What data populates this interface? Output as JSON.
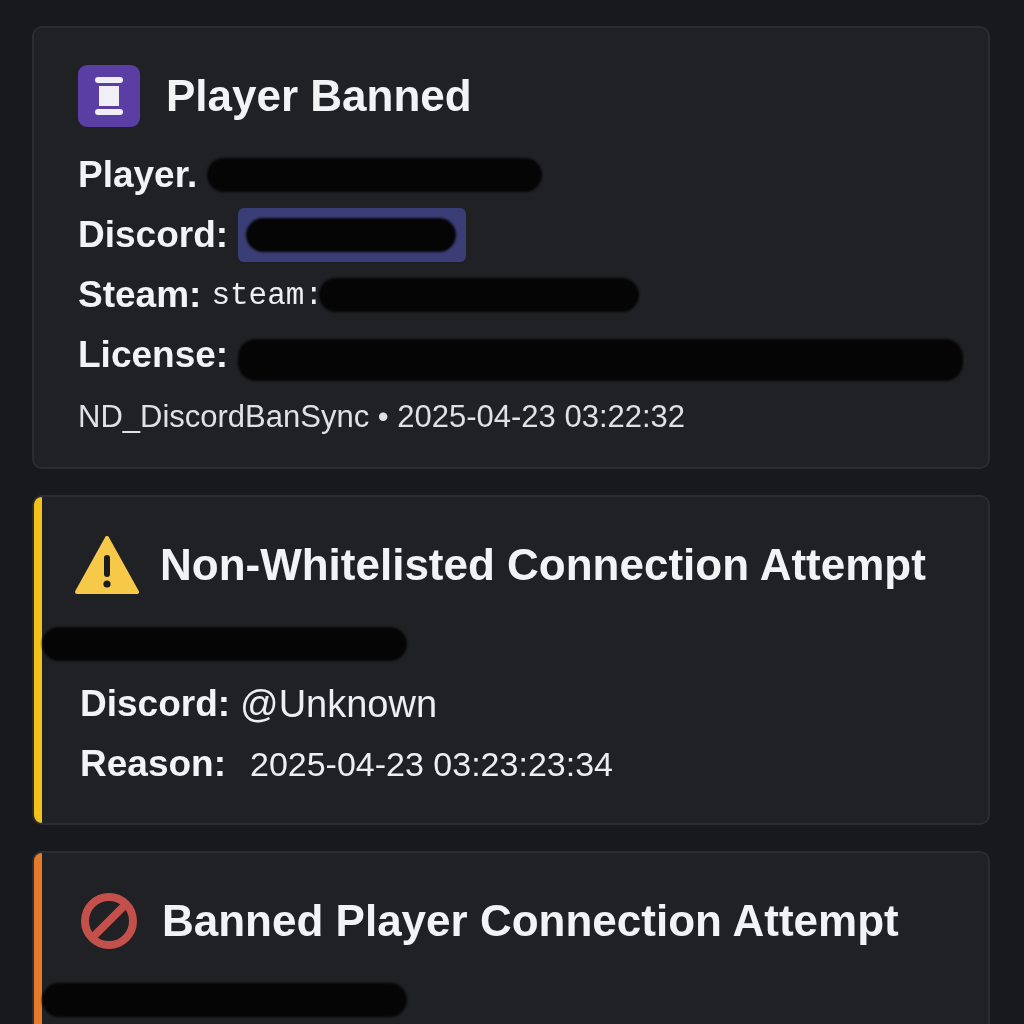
{
  "cards": [
    {
      "kind": "ban",
      "title": "Player Banned",
      "fields": [
        {
          "kind": "text",
          "label": "Player.",
          "redacted": true
        },
        {
          "kind": "mention",
          "label": "Discord:",
          "redacted": true
        },
        {
          "kind": "code",
          "label": "Steam:",
          "value": "steam:",
          "redacted": true
        },
        {
          "kind": "text",
          "label": "License:",
          "redacted": true
        }
      ],
      "footer": "ND_DiscordBanSync • 2025-04-23 03:22:32"
    },
    {
      "kind": "warning",
      "color": "#f2c21b",
      "title": "Non-Whitelisted Connection Attempt",
      "fields": [
        {
          "kind": "text",
          "redacted": true
        },
        {
          "kind": "text",
          "label": "Discord:",
          "value": "@Unknown"
        },
        {
          "kind": "text",
          "label": "Reason:",
          "value": "2025-04-23 03:23:23:34"
        }
      ]
    },
    {
      "kind": "blocked",
      "color": "#e37b2b",
      "title": "Banned Player Connection Attempt",
      "fields": [
        {
          "kind": "text",
          "redacted": true
        }
      ]
    }
  ]
}
